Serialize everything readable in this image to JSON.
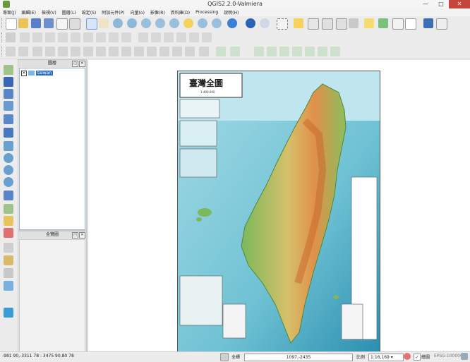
{
  "window": {
    "title": "QGIS2.2.0-Valmiera",
    "min": "—",
    "max": "□",
    "close": "✕"
  },
  "menu": [
    "專案(J)",
    "編輯(E)",
    "檢視(V)",
    "圖層(L)",
    "設定(S)",
    "附加元件(P)",
    "向量(o)",
    "影像(R)",
    "資料庫(D)",
    "Processing",
    "說明(H)"
  ],
  "layers_panel": {
    "title": "圖層",
    "layer_name": "taiwan",
    "checked": "✕"
  },
  "overview_panel": {
    "title": "全覽圖"
  },
  "map": {
    "title_text": "臺灣全圖",
    "subtitle_text": "1:400,000"
  },
  "status": {
    "coords": "-981 90,-3311 78 : 3475 90,80 78",
    "extent_label": "全標",
    "coordinate_value": "1097,-2435",
    "scale_label": "比例",
    "scale_value": "1:16,169",
    "render_label": "繪圖",
    "epsg": "EPSG:100000"
  },
  "colors": {
    "accent": "#2e6fc0",
    "close": "#c7463b",
    "sea": "#8fd0e0",
    "land_green": "#7cb85c",
    "land_orange": "#e0904a"
  },
  "icons": {
    "toolbar_row1": [
      "new-project-icon",
      "open-project-icon",
      "save-project-icon",
      "save-as-icon",
      "print-composer-icon",
      "composer-manager-icon",
      "pan-icon",
      "pan-to-selection-icon",
      "zoom-in-icon",
      "zoom-out-icon",
      "zoom-actual-icon",
      "zoom-full-icon",
      "zoom-layer-icon",
      "zoom-selection-icon",
      "zoom-last-icon",
      "zoom-next-icon",
      "refresh-icon",
      "identify-icon",
      "info-icon",
      "select-icon",
      "deselect-icon",
      "attribute-table-icon",
      "field-calc-icon",
      "measure-icon",
      "annotation-icon",
      "tips-icon",
      "label-icon",
      "text-icon",
      "map-tips-icon",
      "whats-this-icon"
    ],
    "left_toolbar": [
      "add-vector-icon",
      "add-raster-icon",
      "add-postgis-icon",
      "add-spatialite-icon",
      "add-mssql-icon",
      "add-oracle-icon",
      "add-wms-icon",
      "add-wcs-icon",
      "add-wfs-icon",
      "add-delimited-icon",
      "add-gps-icon",
      "new-shapefile-icon",
      "new-spatialite-icon",
      "new-memory-icon",
      "digitize-icon",
      "node-tool-icon",
      "gps-icon",
      "georef-icon"
    ]
  }
}
